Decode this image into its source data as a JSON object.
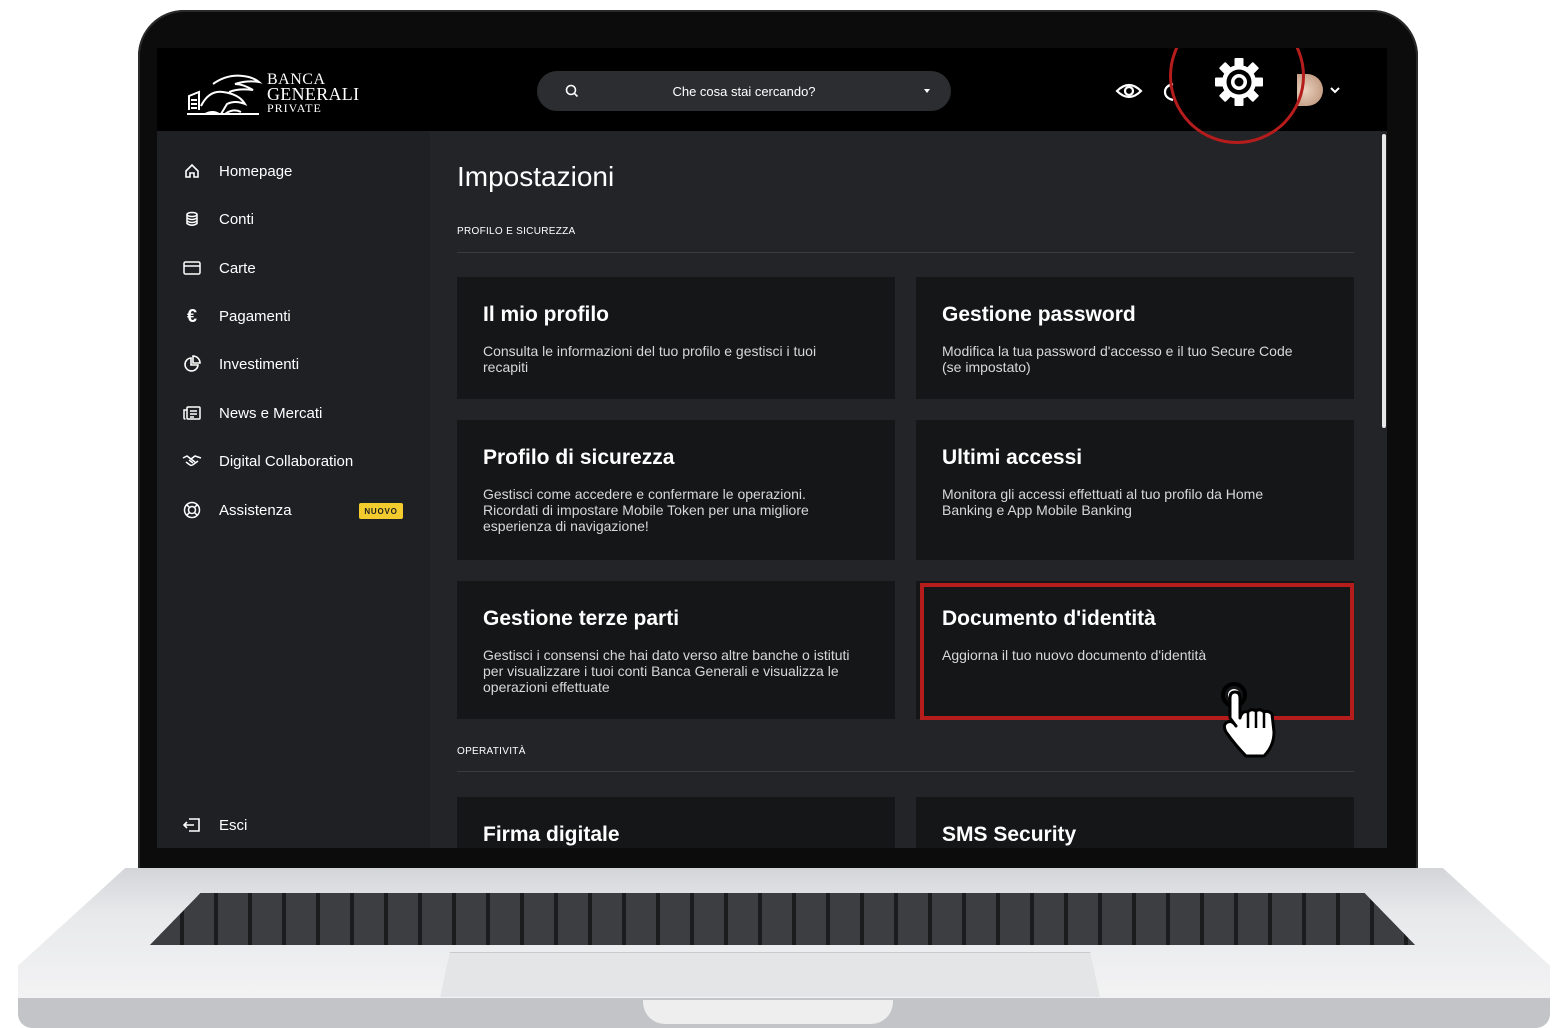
{
  "logo": {
    "line1": "BANCA",
    "line2": "GENERALI",
    "line3": "PRIVATE"
  },
  "search": {
    "placeholder": "Che cosa stai cercando?"
  },
  "header_icons": [
    "eye-icon",
    "gear-icon",
    "avatar",
    "chevron-down-icon"
  ],
  "sidebar": {
    "items": [
      {
        "label": "Homepage",
        "icon": "home-icon"
      },
      {
        "label": "Conti",
        "icon": "coins-icon"
      },
      {
        "label": "Carte",
        "icon": "card-icon"
      },
      {
        "label": "Pagamenti",
        "icon": "euro-icon"
      },
      {
        "label": "Investimenti",
        "icon": "pie-chart-icon"
      },
      {
        "label": "News e Mercati",
        "icon": "newspaper-icon"
      },
      {
        "label": "Digital Collaboration",
        "icon": "handshake-icon"
      },
      {
        "label": "Assistenza",
        "icon": "lifebuoy-icon",
        "badge": "NUOVO"
      }
    ],
    "logout": {
      "label": "Esci",
      "icon": "logout-icon"
    }
  },
  "page": {
    "title": "Impostazioni",
    "sections": [
      {
        "title": "PROFILO E SICUREZZA",
        "cards": [
          {
            "title": "Il mio profilo",
            "desc": "Consulta le informazioni del tuo profilo e gestisci i tuoi recapiti"
          },
          {
            "title": "Gestione password",
            "desc": "Modifica la tua password d'accesso e il tuo Secure Code (se impostato)"
          },
          {
            "title": "Profilo di sicurezza",
            "desc": "Gestisci come accedere e confermare le operazioni. Ricordati di impostare Mobile Token per una migliore esperienza di navigazione!"
          },
          {
            "title": "Ultimi accessi",
            "desc": "Monitora gli accessi effettuati al tuo profilo da Home Banking e App Mobile Banking"
          },
          {
            "title": "Gestione terze parti",
            "desc": "Gestisci i consensi che hai dato verso altre banche o istituti per visualizzare i tuoi conti Banca Generali e visualizza le operazioni effettuate"
          },
          {
            "title": "Documento d'identità",
            "desc": "Aggiorna il tuo nuovo documento d'identità"
          }
        ]
      },
      {
        "title": "OPERATIVITÀ",
        "cards": [
          {
            "title": "Firma digitale"
          },
          {
            "title": "SMS Security"
          }
        ]
      }
    ]
  },
  "colors": {
    "highlight": "#b51c1c",
    "badge": "#f5cc2e",
    "background": "#222428",
    "card": "#151617"
  }
}
